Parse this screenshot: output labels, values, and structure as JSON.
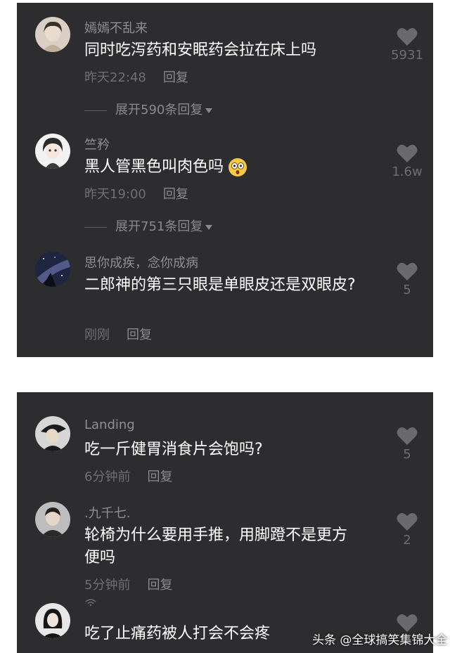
{
  "panel1": {
    "comments": [
      {
        "username": "嫣嫣不乱来",
        "text": "同时吃泻药和安眠药会拉在床上吗",
        "time": "昨天22:48",
        "reply": "回复",
        "likes": "5931",
        "expand": "展开590条回复",
        "avatar_icon": "avatar-portrait-icon"
      },
      {
        "username": "竺矜",
        "text": "黑人管黑色叫肉色吗",
        "time": "昨天19:00",
        "reply": "回复",
        "likes": "1.6w",
        "expand": "展开751条回复",
        "avatar_icon": "avatar-anime-girl-icon",
        "emoji": "shocked-face-emoji"
      },
      {
        "username": "思你成疾，念你成病",
        "text": "二郎神的第三只眼是单眼皮还是双眼皮?",
        "time": "刚刚",
        "reply": "回复",
        "likes": "5",
        "avatar_icon": "avatar-galaxy-icon"
      }
    ]
  },
  "panel2": {
    "comments": [
      {
        "username": "Landing",
        "text": "吃一斤健胃消食片会饱吗?",
        "time": "6分钟前",
        "reply": "回复",
        "likes": "5",
        "avatar_icon": "avatar-plague-doctor-icon"
      },
      {
        "username": ".九千七.",
        "text": "轮椅为什么要用手推，用脚蹬不是更方便吗",
        "time": "5分钟前",
        "reply": "回复",
        "likes": "2",
        "avatar_icon": "avatar-person-icon"
      },
      {
        "username": "",
        "text": "吃了止痛药被人打会不会疼",
        "avatar_icon": "avatar-woman-icon"
      }
    ]
  },
  "watermark": "头条 @全球搞笑集锦大全",
  "colors": {
    "panel": "#2d2d2f",
    "text": "#ffffff",
    "muted": "#8f8f93",
    "heart": "#6a6a6e"
  }
}
